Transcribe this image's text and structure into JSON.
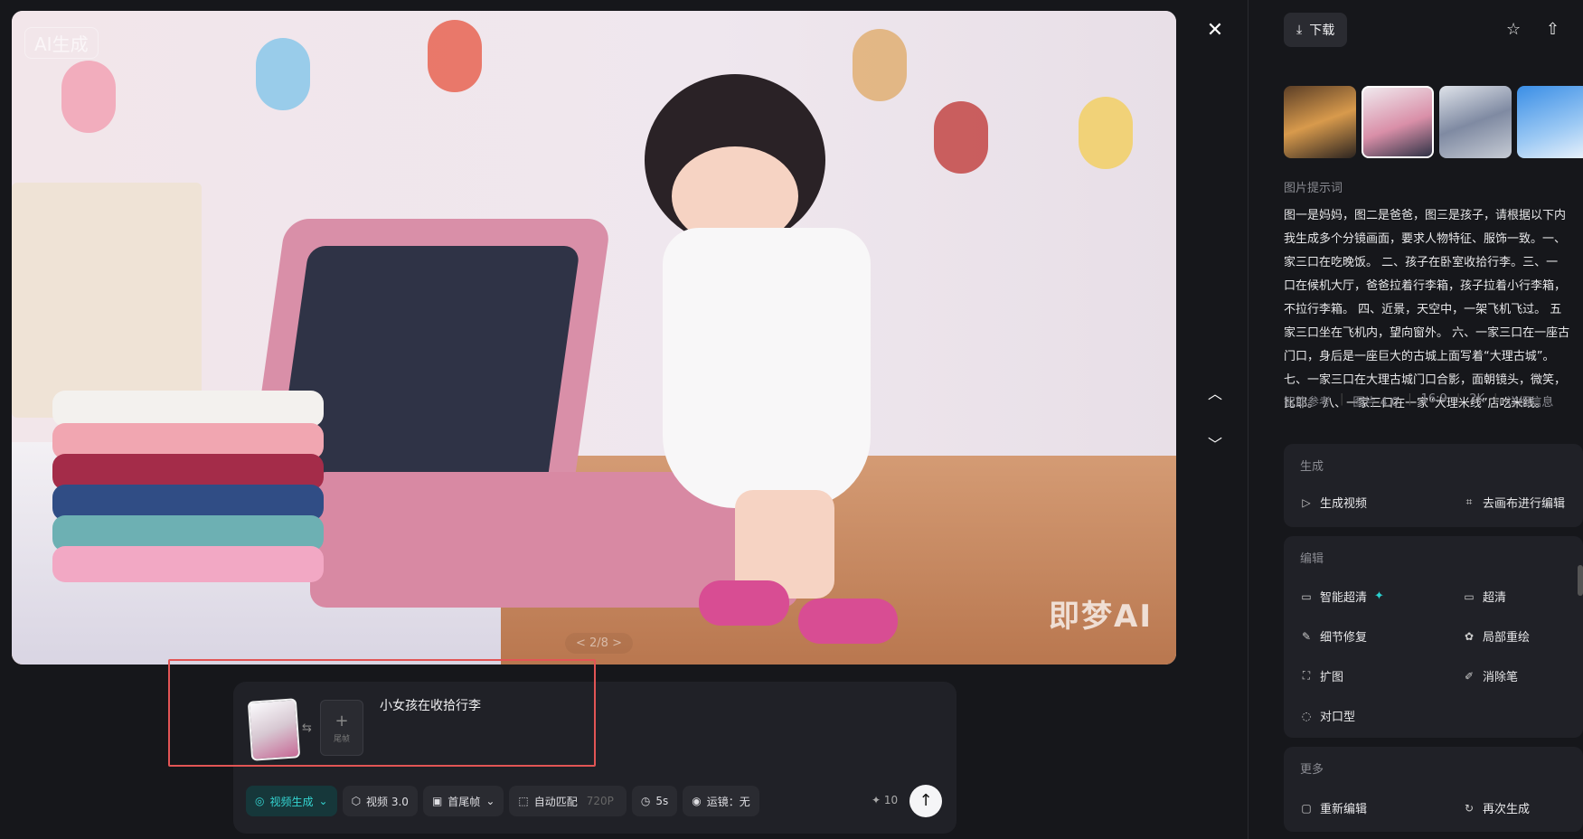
{
  "preview": {
    "watermark_top_left": "AI生成",
    "watermark_bottom_right": "即梦AI",
    "pager": "< 2/8 >"
  },
  "controls": {
    "close": "✕",
    "up": "︿",
    "down": "﹀"
  },
  "composer": {
    "prompt": "小女孩在收拾行李",
    "end_frame_label": "尾帧",
    "end_frame_plus": "+",
    "swap": "⇆",
    "toolbar": [
      {
        "label": "视频生成",
        "icon": "◎",
        "extra": "⌄"
      },
      {
        "label": "视频 3.0",
        "icon": "⬡"
      },
      {
        "label": "首尾帧",
        "icon": "▣",
        "extra": "⌄"
      },
      {
        "label": "自动匹配",
        "icon": "⬚",
        "extra": "720P"
      },
      {
        "label": "5s",
        "icon": "◷"
      },
      {
        "label": "运镜：无",
        "icon": "◉"
      }
    ],
    "credits": "✦ 10",
    "send": "↑"
  },
  "right_panel": {
    "download": "下载",
    "download_icon": "⤓",
    "star_icon": "☆",
    "share_icon": "⇧",
    "prompt_label": "图片提示词",
    "prompt_lines": [
      "图一是妈妈，图二是爸爸，图三是孩子，请根据以下内",
      "我生成多个分镜画面，要求人物特征、服饰一致。一、",
      "家三口在吃晚饭。 二、孩子在卧室收拾行李。三、一",
      "口在候机大厅，爸爸拉着行李箱，孩子拉着小行李箱，",
      "不拉行李箱。 四、近景，天空中，一架飞机飞过。 五",
      "家三口坐在飞机内，望向窗外。 六、一家三口在一座古",
      "门口，身后是一座巨大的古城上面写着“大理古城”。",
      "七、一家三口在大理古城门口合影，面朝镜头，微笑，",
      "比耶。 八、一家三口在一家“大理米线”店吃米线。"
    ],
    "meta": [
      "智能参考",
      "图片 4.0",
      "16:9",
      "2K",
      "详细信息"
    ],
    "sections": {
      "generate": {
        "title": "生成",
        "items": [
          {
            "label": "生成视频",
            "icon": "▷"
          },
          {
            "label": "去画布进行编辑",
            "icon": "⌗"
          }
        ]
      },
      "edit": {
        "title": "编辑",
        "items": [
          {
            "label": "智能超清",
            "icon": "▭",
            "spark": "✦"
          },
          {
            "label": "超清",
            "icon": "▭"
          },
          {
            "label": "细节修复",
            "icon": "✎"
          },
          {
            "label": "局部重绘",
            "icon": "✿"
          },
          {
            "label": "扩图",
            "icon": "⛶"
          },
          {
            "label": "消除笔",
            "icon": "✐"
          },
          {
            "label": "对口型",
            "icon": "◌"
          }
        ]
      },
      "more": {
        "title": "更多",
        "items": [
          {
            "label": "重新编辑",
            "icon": "▢"
          },
          {
            "label": "再次生成",
            "icon": "↻"
          }
        ]
      }
    }
  }
}
